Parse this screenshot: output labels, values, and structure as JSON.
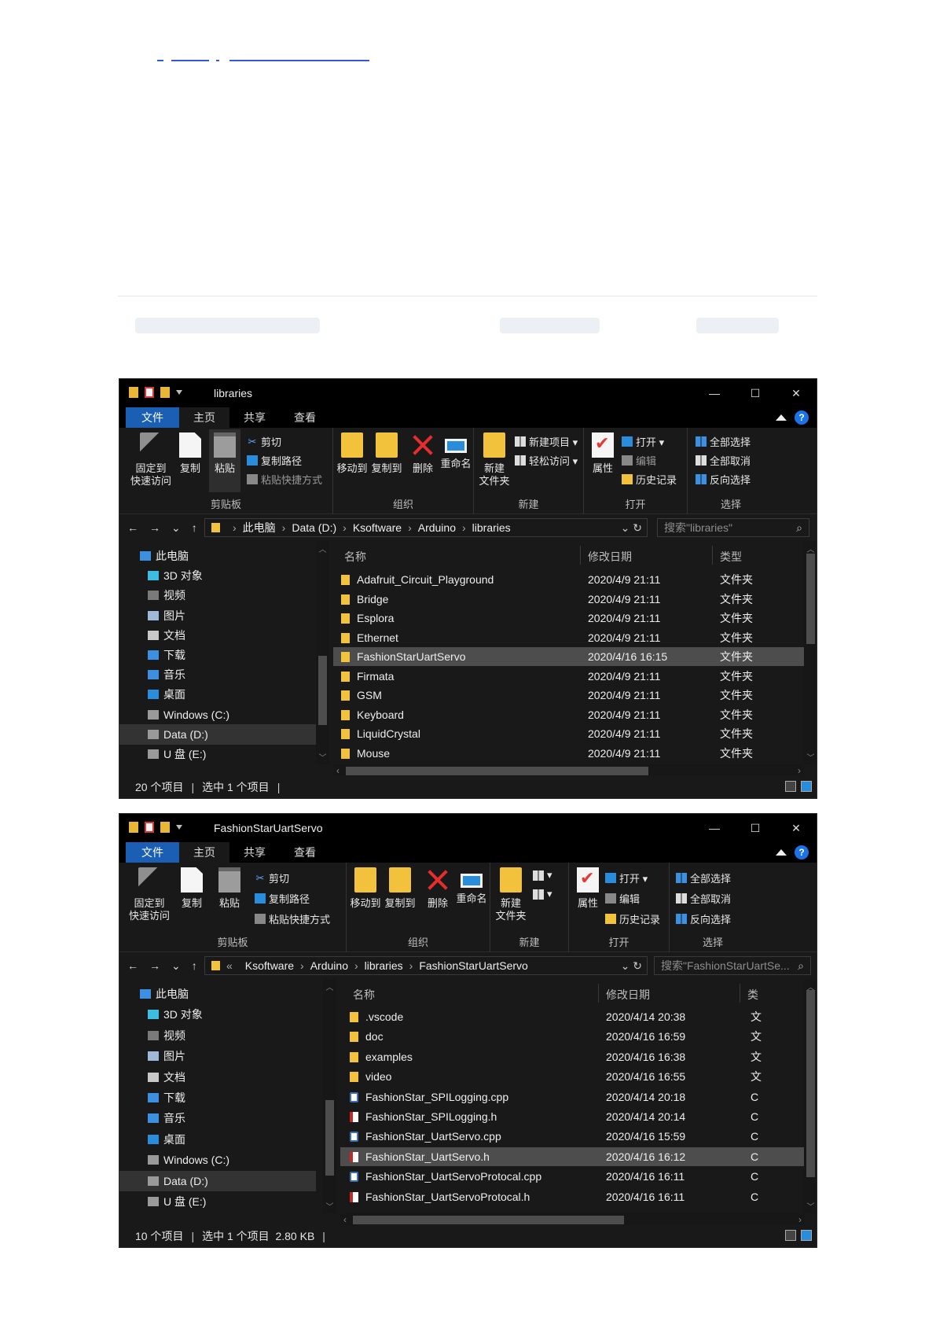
{
  "window1": {
    "title": "libraries",
    "controls": {
      "min": "—",
      "max": "☐",
      "close": "✕"
    },
    "tabs": [
      "文件",
      "主页",
      "共享",
      "查看"
    ],
    "ribbon": {
      "pin_line1": "固定到",
      "pin_line2": "快速访问",
      "copy": "复制",
      "paste": "粘贴",
      "cut": "剪切",
      "copy_path": "复制路径",
      "paste_shortcut": "粘贴快捷方式",
      "group_clipboard": "剪贴板",
      "move_to": "移动到",
      "copy_to": "复制到",
      "delete": "删除",
      "rename": "重命名",
      "group_organize": "组织",
      "new_folder_line1": "新建",
      "new_folder_line2": "文件夹",
      "new_item": "新建项目 ▾",
      "easy_access": "轻松访问 ▾",
      "group_new": "新建",
      "properties": "属性",
      "open": "打开 ▾",
      "edit": "编辑",
      "history": "历史记录",
      "group_open": "打开",
      "select_all": "全部选择",
      "select_none": "全部取消",
      "invert": "反向选择",
      "group_select": "选择"
    },
    "nav_buttons": [
      "←",
      "→",
      "⌄",
      "↑"
    ],
    "address": [
      "此电脑",
      "Data (D:)",
      "Ksoftware",
      "Arduino",
      "libraries"
    ],
    "search_placeholder": "搜索\"libraries\"",
    "nav_pane": [
      "此电脑",
      "3D 对象",
      "视频",
      "图片",
      "文档",
      "下载",
      "音乐",
      "桌面",
      "Windows (C:)",
      "Data (D:)",
      "U 盘 (E:)"
    ],
    "columns": [
      "名称",
      "修改日期",
      "类型"
    ],
    "rows": [
      {
        "name": "Adafruit_Circuit_Playground",
        "date": "2020/4/9 21:11",
        "type": "文件夹"
      },
      {
        "name": "Bridge",
        "date": "2020/4/9 21:11",
        "type": "文件夹"
      },
      {
        "name": "Esplora",
        "date": "2020/4/9 21:11",
        "type": "文件夹"
      },
      {
        "name": "Ethernet",
        "date": "2020/4/9 21:11",
        "type": "文件夹"
      },
      {
        "name": "FashionStarUartServo",
        "date": "2020/4/16 16:15",
        "type": "文件夹"
      },
      {
        "name": "Firmata",
        "date": "2020/4/9 21:11",
        "type": "文件夹"
      },
      {
        "name": "GSM",
        "date": "2020/4/9 21:11",
        "type": "文件夹"
      },
      {
        "name": "Keyboard",
        "date": "2020/4/9 21:11",
        "type": "文件夹"
      },
      {
        "name": "LiquidCrystal",
        "date": "2020/4/9 21:11",
        "type": "文件夹"
      },
      {
        "name": "Mouse",
        "date": "2020/4/9 21:11",
        "type": "文件夹"
      }
    ],
    "status": {
      "count": "20 个项目",
      "selected": "选中 1 个项目",
      "size": ""
    }
  },
  "window2": {
    "title": "FashionStarUartServo",
    "controls": {
      "min": "—",
      "max": "☐",
      "close": "✕"
    },
    "tabs": [
      "文件",
      "主页",
      "共享",
      "查看"
    ],
    "ribbon": {
      "pin_line1": "固定到",
      "pin_line2": "快速访问",
      "copy": "复制",
      "paste": "粘贴",
      "cut": "剪切",
      "copy_path": "复制路径",
      "paste_shortcut": "粘贴快捷方式",
      "group_clipboard": "剪贴板",
      "move_to": "移动到",
      "copy_to": "复制到",
      "delete": "删除",
      "rename": "重命名",
      "group_organize": "组织",
      "new_folder_line1": "新建",
      "new_folder_line2": "文件夹",
      "new_item": "▾",
      "easy_access": "▾",
      "group_new": "新建",
      "properties": "属性",
      "open": "打开 ▾",
      "edit": "编辑",
      "history": "历史记录",
      "group_open": "打开",
      "select_all": "全部选择",
      "select_none": "全部取消",
      "invert": "反向选择",
      "group_select": "选择"
    },
    "nav_buttons": [
      "←",
      "→",
      "⌄",
      "↑"
    ],
    "address": [
      "«",
      "Ksoftware",
      "Arduino",
      "libraries",
      "FashionStarUartServo"
    ],
    "search_placeholder": "搜索\"FashionStarUartSe...",
    "nav_pane": [
      "此电脑",
      "3D 对象",
      "视频",
      "图片",
      "文档",
      "下载",
      "音乐",
      "桌面",
      "Windows (C:)",
      "Data (D:)",
      "U 盘 (E:)"
    ],
    "columns": [
      "名称",
      "修改日期",
      "类"
    ],
    "rows": [
      {
        "name": ".vscode",
        "date": "2020/4/14 20:38",
        "type": "文",
        "kind": "fold"
      },
      {
        "name": "doc",
        "date": "2020/4/16 16:59",
        "type": "文",
        "kind": "fold"
      },
      {
        "name": "examples",
        "date": "2020/4/16 16:38",
        "type": "文",
        "kind": "fold"
      },
      {
        "name": "video",
        "date": "2020/4/16 16:55",
        "type": "文",
        "kind": "fold"
      },
      {
        "name": "FashionStar_SPILogging.cpp",
        "date": "2020/4/14 20:18",
        "type": "C",
        "kind": "cpp"
      },
      {
        "name": "FashionStar_SPILogging.h",
        "date": "2020/4/14 20:14",
        "type": "C",
        "kind": "hh"
      },
      {
        "name": "FashionStar_UartServo.cpp",
        "date": "2020/4/16 15:59",
        "type": "C",
        "kind": "cpp"
      },
      {
        "name": "FashionStar_UartServo.h",
        "date": "2020/4/16 16:12",
        "type": "C",
        "kind": "hh"
      },
      {
        "name": "FashionStar_UartServoProtocal.cpp",
        "date": "2020/4/16 16:11",
        "type": "C",
        "kind": "cpp"
      },
      {
        "name": "FashionStar_UartServoProtocal.h",
        "date": "2020/4/16 16:11",
        "type": "C",
        "kind": "hh"
      }
    ],
    "status": {
      "count": "10 个项目",
      "selected": "选中 1 个项目",
      "size": "2.80 KB"
    }
  }
}
